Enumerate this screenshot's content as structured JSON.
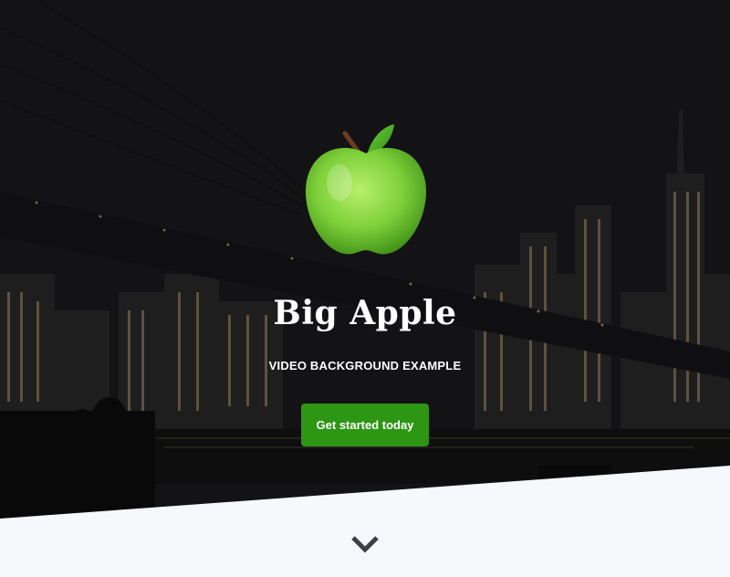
{
  "hero": {
    "title": "Big Apple",
    "subtitle": "VIDEO BACKGROUND EXAMPLE",
    "cta_label": "Get started today",
    "logo_icon": "green-apple-icon",
    "scroll_icon": "chevron-down-icon",
    "background": "night-city-bridge-video"
  },
  "colors": {
    "cta": "#2d9613",
    "bottom_panel": "#f6f8fb",
    "chevron": "#3c3f44"
  }
}
